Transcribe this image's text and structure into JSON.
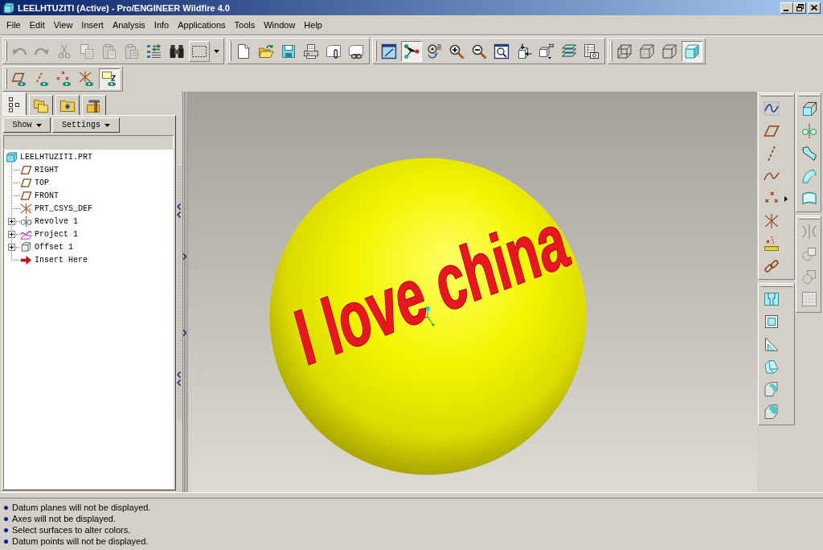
{
  "window": {
    "title": "LEELHTUZITI (Active) - Pro/ENGINEER Wildfire 4.0"
  },
  "menu": [
    "File",
    "Edit",
    "View",
    "Insert",
    "Analysis",
    "Info",
    "Applications",
    "Tools",
    "Window",
    "Help"
  ],
  "main_toolbar": [
    [
      {
        "pressed": false,
        "disabled": true
      },
      {
        "pressed": false,
        "disabled": true
      },
      {
        "pressed": false,
        "disabled": true
      },
      {
        "pressed": false,
        "disabled": true
      },
      {
        "pressed": false,
        "disabled": true
      },
      {
        "pressed": false,
        "disabled": true
      },
      {
        "pressed": false,
        "disabled": false
      },
      {
        "pressed": false,
        "disabled": false
      },
      {
        "pressed": false,
        "disabled": false
      },
      {
        "pressed": false,
        "disabled": false
      }
    ],
    [
      {
        "pressed": false,
        "disabled": false
      },
      {
        "pressed": false,
        "disabled": false
      },
      {
        "pressed": false,
        "disabled": false
      },
      {
        "pressed": false,
        "disabled": false
      },
      {
        "pressed": false,
        "disabled": false
      },
      {
        "pressed": false,
        "disabled": false
      }
    ],
    [
      {
        "pressed": false,
        "disabled": false
      },
      {
        "pressed": true,
        "disabled": false
      },
      {
        "pressed": false,
        "disabled": false
      },
      {
        "pressed": false,
        "disabled": false
      },
      {
        "pressed": false,
        "disabled": false
      },
      {
        "pressed": false,
        "disabled": false
      },
      {
        "pressed": false,
        "disabled": false
      },
      {
        "pressed": false,
        "disabled": false
      },
      {
        "pressed": false,
        "disabled": false
      },
      {
        "pressed": false,
        "disabled": false
      }
    ],
    [
      {
        "pressed": false,
        "disabled": false
      },
      {
        "pressed": false,
        "disabled": false
      },
      {
        "pressed": false,
        "disabled": false
      },
      {
        "pressed": true,
        "disabled": false
      }
    ]
  ],
  "datum_display_toolbar": [
    [
      {
        "pressed": false,
        "disabled": false
      },
      {
        "pressed": false,
        "disabled": false
      },
      {
        "pressed": false,
        "disabled": false
      },
      {
        "pressed": false,
        "disabled": false
      },
      {
        "pressed": true,
        "disabled": false
      }
    ]
  ],
  "navigator": {
    "tabs": [
      {
        "selected": true
      },
      {
        "selected": false
      },
      {
        "selected": false
      },
      {
        "selected": false
      }
    ],
    "buttons": [
      "Show",
      "Settings"
    ],
    "tree": {
      "label": "LEELHTUZITI.PRT",
      "kind": "part",
      "children": [
        {
          "label": "RIGHT",
          "kind": "plane"
        },
        {
          "label": "TOP",
          "kind": "plane"
        },
        {
          "label": "FRONT",
          "kind": "plane"
        },
        {
          "label": "PRT_CSYS_DEF",
          "kind": "csys"
        },
        {
          "label": "Revolve 1",
          "kind": "revolve",
          "expanded": false
        },
        {
          "label": "Project 1",
          "kind": "project",
          "expanded": false
        },
        {
          "label": "Offset 1",
          "kind": "offset",
          "expanded": false
        },
        {
          "label": "Insert Here",
          "kind": "insert"
        }
      ]
    }
  },
  "viewport": {
    "model_text": "I love china"
  },
  "feature_toolbars": [
    [
      [
        {
          "pressed": false,
          "disabled": false
        },
        {
          "pressed": false,
          "disabled": false
        },
        {
          "pressed": false,
          "disabled": false
        },
        {
          "pressed": false,
          "disabled": false
        },
        {
          "pressed": false,
          "disabled": false
        },
        {
          "pressed": false,
          "disabled": false
        },
        {
          "pressed": false,
          "disabled": false
        },
        {
          "pressed": false,
          "disabled": false
        }
      ],
      [
        {
          "pressed": false,
          "disabled": false
        },
        {
          "pressed": false,
          "disabled": false
        },
        {
          "pressed": false,
          "disabled": false
        },
        {
          "pressed": false,
          "disabled": false
        },
        {
          "pressed": false,
          "disabled": false
        },
        {
          "pressed": false,
          "disabled": false
        }
      ]
    ],
    [
      [
        {
          "pressed": false,
          "disabled": false
        },
        {
          "pressed": false,
          "disabled": false
        },
        {
          "pressed": false,
          "disabled": false
        },
        {
          "pressed": false,
          "disabled": false
        },
        {
          "pressed": false,
          "disabled": false
        }
      ],
      [
        {
          "pressed": false,
          "disabled": true
        },
        {
          "pressed": false,
          "disabled": true
        },
        {
          "pressed": false,
          "disabled": true
        },
        {
          "pressed": false,
          "disabled": true
        }
      ]
    ]
  ],
  "messages": [
    "Datum planes will not be displayed.",
    "Axes will not be displayed.",
    "Select surfaces to alter colors.",
    "Datum points will not be displayed."
  ]
}
